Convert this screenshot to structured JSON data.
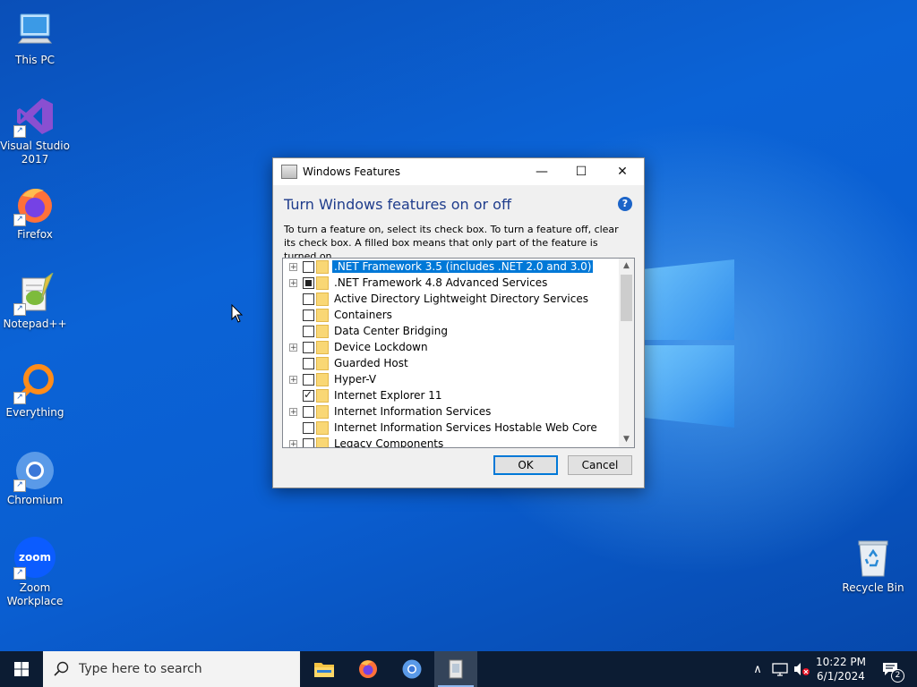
{
  "desktop": {
    "icons": [
      {
        "label": "This PC"
      },
      {
        "label": "Visual Studio 2017"
      },
      {
        "label": "Firefox"
      },
      {
        "label": "Notepad++"
      },
      {
        "label": "Everything"
      },
      {
        "label": "Chromium"
      },
      {
        "label": "Zoom Workplace"
      },
      {
        "label": "Recycle Bin"
      }
    ],
    "zoom_icon_text": "zoom",
    "shortcut_glyph": "↗"
  },
  "dialog": {
    "title": "Windows Features",
    "heading": "Turn Windows features on or off",
    "description": "To turn a feature on, select its check box. To turn a feature off, clear its check box. A filled box means that only part of the feature is turned on.",
    "features": [
      {
        "label": ".NET Framework 3.5 (includes .NET 2.0 and 3.0)",
        "expandable": true,
        "state": "unchecked",
        "selected": true
      },
      {
        "label": ".NET Framework 4.8 Advanced Services",
        "expandable": true,
        "state": "partial",
        "selected": false
      },
      {
        "label": "Active Directory Lightweight Directory Services",
        "expandable": false,
        "state": "unchecked",
        "selected": false
      },
      {
        "label": "Containers",
        "expandable": false,
        "state": "unchecked",
        "selected": false
      },
      {
        "label": "Data Center Bridging",
        "expandable": false,
        "state": "unchecked",
        "selected": false
      },
      {
        "label": "Device Lockdown",
        "expandable": true,
        "state": "unchecked",
        "selected": false
      },
      {
        "label": "Guarded Host",
        "expandable": false,
        "state": "unchecked",
        "selected": false
      },
      {
        "label": "Hyper-V",
        "expandable": true,
        "state": "unchecked",
        "selected": false
      },
      {
        "label": "Internet Explorer 11",
        "expandable": false,
        "state": "checked",
        "selected": false
      },
      {
        "label": "Internet Information Services",
        "expandable": true,
        "state": "unchecked",
        "selected": false
      },
      {
        "label": "Internet Information Services Hostable Web Core",
        "expandable": false,
        "state": "unchecked",
        "selected": false
      },
      {
        "label": "Legacy Components",
        "expandable": true,
        "state": "unchecked",
        "selected": false
      }
    ],
    "ok_label": "OK",
    "cancel_label": "Cancel",
    "help_glyph": "?",
    "minimize_glyph": "—",
    "maximize_glyph": "☐",
    "close_glyph": "✕",
    "expand_glyph": "+",
    "scroll_up_glyph": "▲",
    "scroll_down_glyph": "▼"
  },
  "taskbar": {
    "search_placeholder": "Type here to search",
    "tray_chevron": "∧",
    "notification_count": "2",
    "time": "10:22 PM",
    "date": "6/1/2024"
  },
  "colors": {
    "accent": "#0078d7",
    "heading": "#1e3c8c",
    "taskbar": "#0c1c33"
  }
}
